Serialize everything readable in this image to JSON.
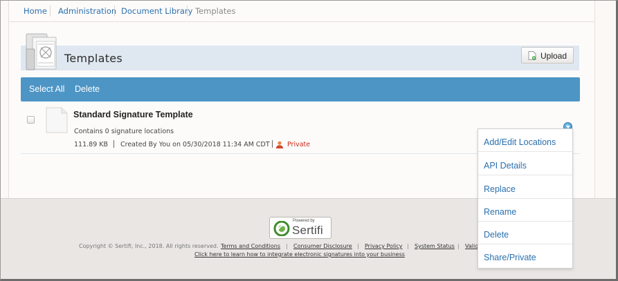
{
  "breadcrumb": {
    "items": [
      "Home",
      "Administration",
      "Document Library",
      "Templates"
    ]
  },
  "header": {
    "title": "Templates",
    "upload_label": "Upload"
  },
  "actions": {
    "select_all": "Select All",
    "delete": "Delete"
  },
  "document": {
    "name": "Standard Signature Template",
    "description": "Contains 0 signature locations",
    "size": "111.89 KB",
    "created": "Created By You on 05/30/2018 11:34 AM CDT",
    "visibility": "Private"
  },
  "menu": {
    "items": [
      "Add/Edit Locations",
      "API Details",
      "Replace",
      "Rename",
      "Delete",
      "Share/Private"
    ]
  },
  "footer": {
    "powered_by": "Powered by",
    "brand": "Sertifi",
    "copyright": "Copyright © Sertifi, Inc., 2018. All rights reserved.",
    "links": [
      "Terms and Conditions",
      "Consumer Disclosure",
      "Privacy Policy",
      "System Status",
      "Valid"
    ],
    "integrate_link": "Click here to learn how to integrate electronic signatures into your business"
  },
  "colors": {
    "action_bar": "#4d95c5",
    "link": "#2a6fad",
    "private": "#cc2a1a",
    "header_band": "#dfe8f1"
  }
}
